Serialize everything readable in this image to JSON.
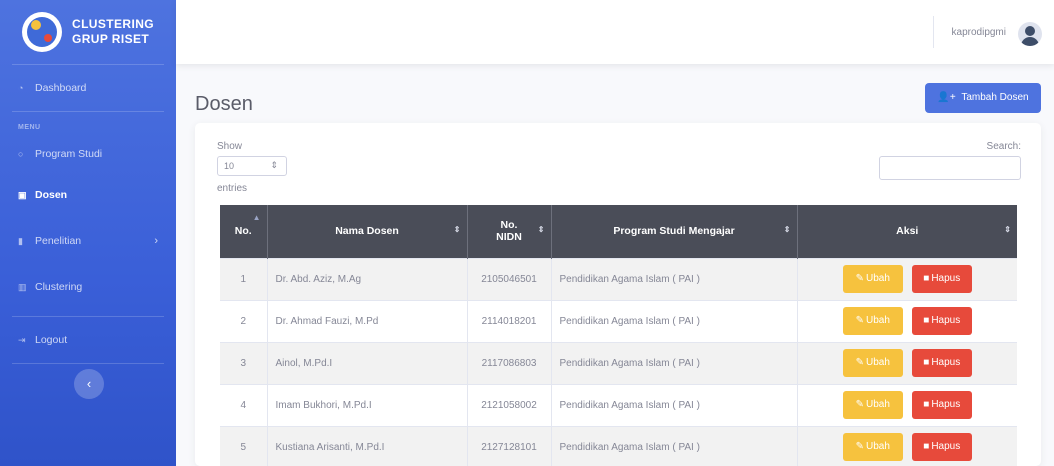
{
  "sidebar": {
    "brand_line1": "CLUSTERING",
    "brand_line2": "GRUP RISET",
    "dashboard": "Dashboard",
    "menu_heading": "MENU",
    "items": [
      {
        "label": "Program Studi",
        "icon": "circle-icon"
      },
      {
        "label": "Dosen",
        "icon": "chalkboard-icon"
      },
      {
        "label": "Penelitian",
        "icon": "chart-icon"
      },
      {
        "label": "Clustering",
        "icon": "bars-icon"
      }
    ],
    "logout": "Logout",
    "toggle_glyph": "‹"
  },
  "topbar": {
    "user_name": "kaprodipgmi"
  },
  "page": {
    "title": "Dosen",
    "add_button": "Tambah Dosen"
  },
  "table_controls": {
    "show_label": "Show",
    "entries_value": "10",
    "entries_label": "entries",
    "search_label": "Search:"
  },
  "table": {
    "columns": [
      "No.",
      "Nama Dosen",
      "No. NIDN",
      "Program Studi Mengajar",
      "Aksi"
    ],
    "rows": [
      {
        "no": "1",
        "nama": "Dr. Abd. Aziz, M.Ag",
        "nidn": "2105046501",
        "prodi": "Pendidikan Agama Islam ( PAI )"
      },
      {
        "no": "2",
        "nama": "Dr. Ahmad Fauzi, M.Pd",
        "nidn": "2114018201",
        "prodi": "Pendidikan Agama Islam ( PAI )"
      },
      {
        "no": "3",
        "nama": "Ainol, M.Pd.I",
        "nidn": "2117086803",
        "prodi": "Pendidikan Agama Islam ( PAI )"
      },
      {
        "no": "4",
        "nama": "Imam Bukhori, M.Pd.I",
        "nidn": "2121058002",
        "prodi": "Pendidikan Agama Islam ( PAI )"
      },
      {
        "no": "5",
        "nama": "Kustiana Arisanti, M.Pd.I",
        "nidn": "2127128101",
        "prodi": "Pendidikan Agama Islam ( PAI )"
      }
    ],
    "edit_label": "Ubah",
    "delete_label": "Hapus"
  },
  "colors": {
    "primary": "#4e73df",
    "warning": "#f6c23e",
    "danger": "#e74a3b",
    "table_header": "#4a4d58"
  }
}
